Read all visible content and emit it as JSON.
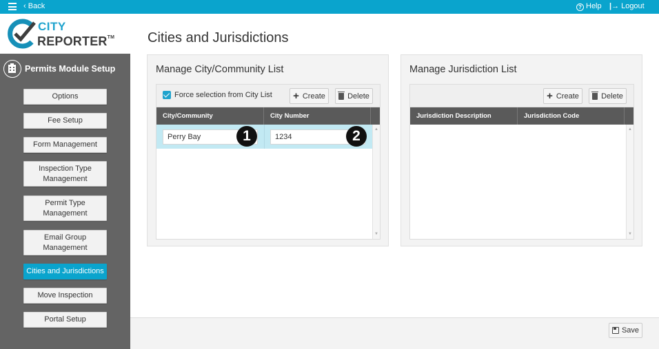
{
  "topbar": {
    "back_label": "Back",
    "help_label": "Help",
    "logout_label": "Logout",
    "help_glyph": "?",
    "logout_glyph": "|→",
    "back_glyph": "‹"
  },
  "logo": {
    "line1": "CITY",
    "line2": "REPORTER",
    "tm": "TM"
  },
  "sidebar": {
    "module_title": "Permits Module Setup",
    "items": [
      {
        "label": "Options",
        "active": false
      },
      {
        "label": "Fee Setup",
        "active": false
      },
      {
        "label": "Form Management",
        "active": false
      },
      {
        "label": "Inspection Type Management",
        "active": false
      },
      {
        "label": "Permit Type Management",
        "active": false
      },
      {
        "label": "Email Group Management",
        "active": false
      },
      {
        "label": "Cities and Jurisdictions",
        "active": true
      },
      {
        "label": "Move Inspection",
        "active": false
      },
      {
        "label": "Portal Setup",
        "active": false
      }
    ]
  },
  "main": {
    "page_title": "Cities and Jurisdictions",
    "city_panel": {
      "title": "Manage City/Community List",
      "checkbox_label": "Force selection from City List",
      "checkbox_checked": true,
      "create_label": "Create",
      "delete_label": "Delete",
      "columns": [
        "City/Community",
        "City Number"
      ],
      "rows": [
        {
          "city": "Perry Bay",
          "number": "1234"
        }
      ]
    },
    "jurisdiction_panel": {
      "title": "Manage Jurisdiction List",
      "create_label": "Create",
      "delete_label": "Delete",
      "columns": [
        "Jurisdiction Description",
        "Jurisdiction Code"
      ],
      "rows": []
    },
    "annotations": [
      "1",
      "2"
    ],
    "save_label": "Save"
  },
  "colors": {
    "accent": "#0aa4cd",
    "sidebar_bg": "#646464",
    "grid_header": "#5a5a5a",
    "selected_row": "#c2e9f3"
  }
}
